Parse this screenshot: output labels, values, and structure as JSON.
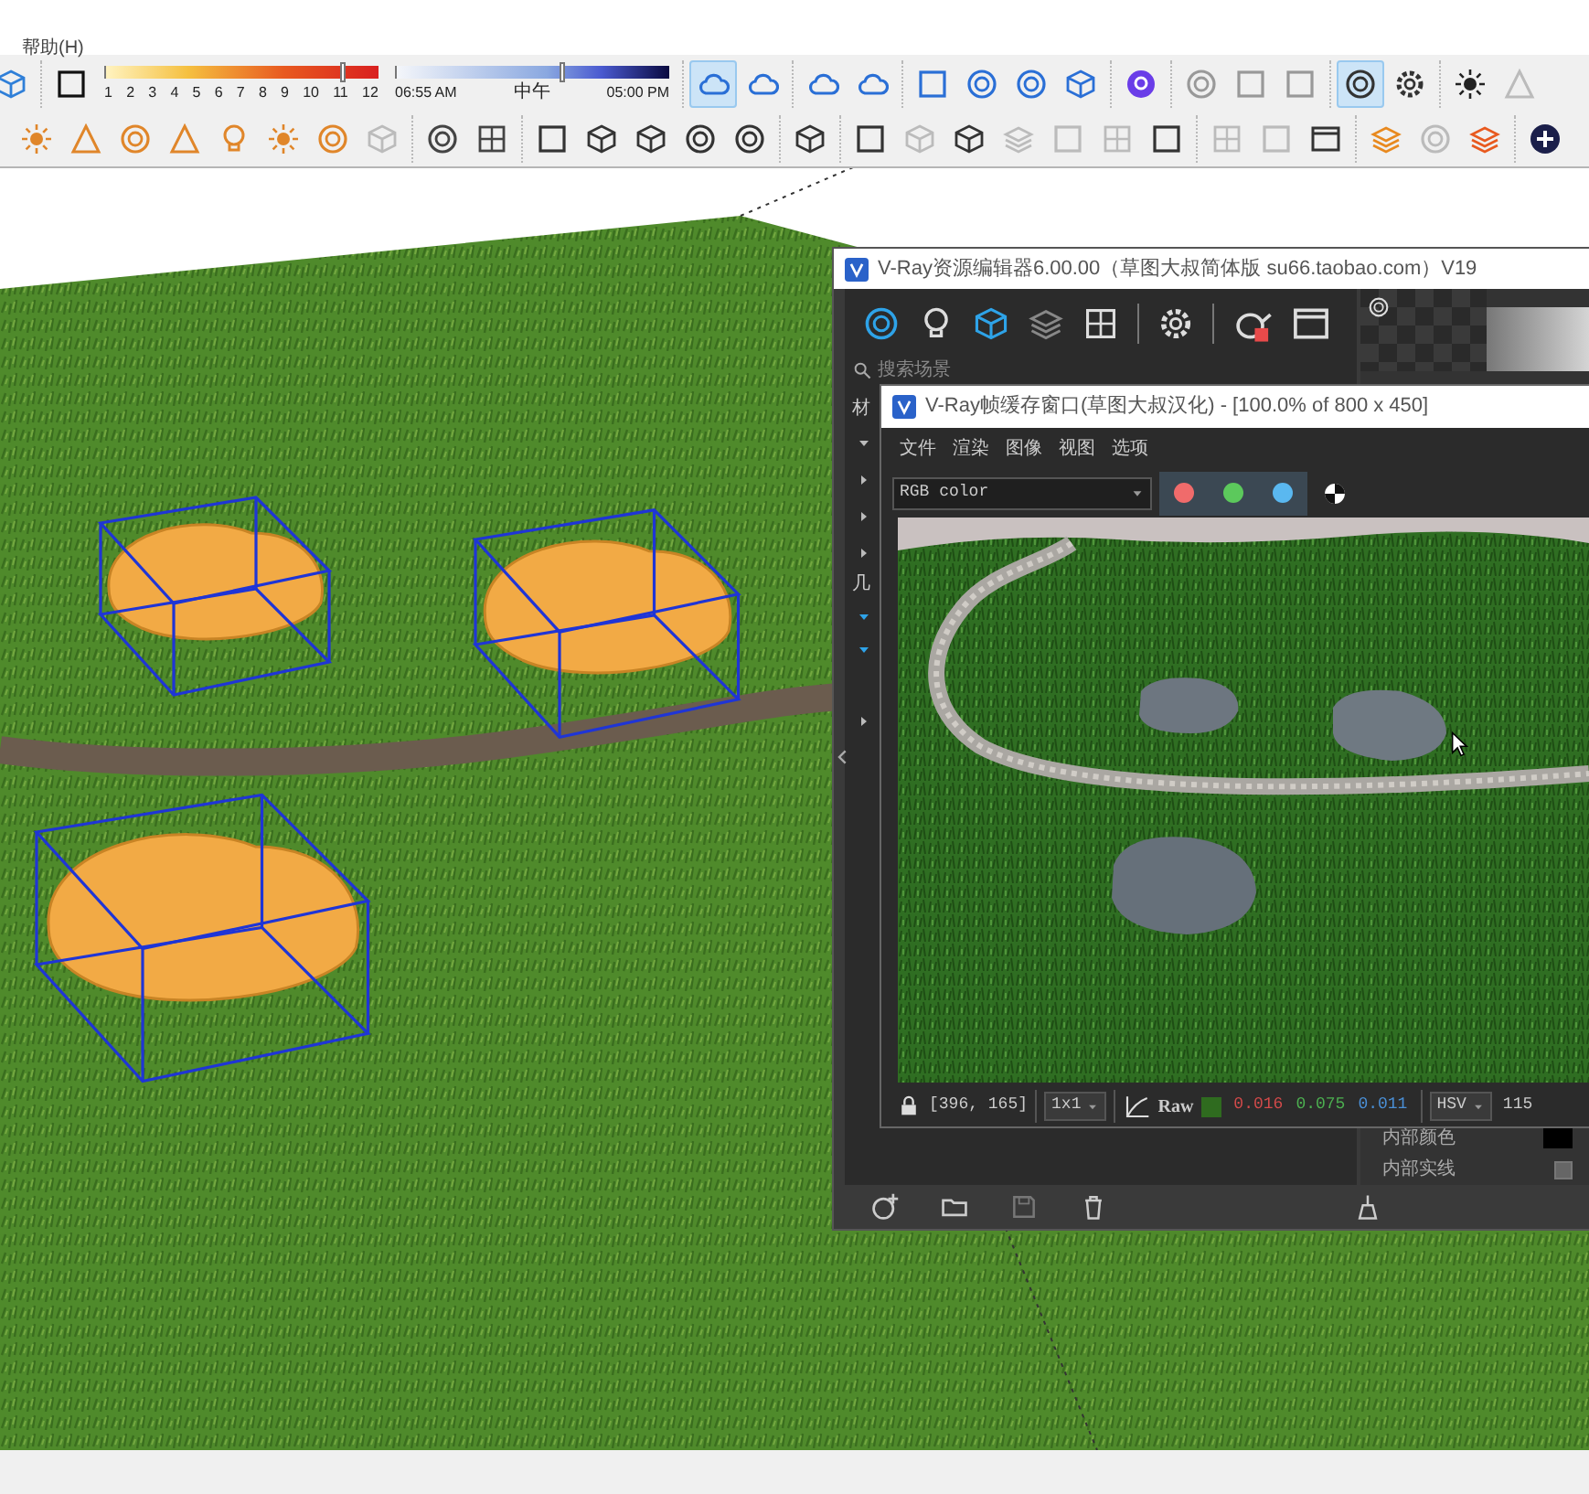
{
  "menu_bar": {
    "items": [
      "帮助(H)"
    ]
  },
  "toolbar_rows": [
    {
      "groups": [
        [
          {
            "kind": "button",
            "on": false
          }
        ],
        [
          {
            "kind": "button",
            "on": false
          },
          {
            "kind": "hour-scale",
            "labels": [
              "1",
              "2",
              "3",
              "4",
              "5",
              "6",
              "7",
              "8",
              "9",
              "10",
              "11",
              "12"
            ],
            "level": 0.87
          },
          {
            "kind": "time-slider",
            "labels": [
              "06:55 AM",
              "中午",
              "05:00 PM"
            ],
            "level": 0.61
          }
        ],
        [
          {
            "kind": "button",
            "on": true
          },
          {
            "kind": "button",
            "on": false
          }
        ],
        [
          {
            "kind": "button",
            "on": false
          },
          {
            "kind": "button",
            "on": false
          }
        ],
        [
          {
            "kind": "button",
            "on": false
          },
          {
            "kind": "button",
            "on": false
          },
          {
            "kind": "button",
            "on": false
          },
          {
            "kind": "button",
            "on": false
          }
        ],
        [
          {
            "kind": "button",
            "on": false
          }
        ],
        [
          {
            "kind": "button",
            "on": false
          },
          {
            "kind": "button",
            "on": false
          },
          {
            "kind": "button",
            "on": false
          }
        ],
        [
          {
            "kind": "button",
            "on": true
          },
          {
            "kind": "button",
            "on": false
          }
        ],
        [
          {
            "kind": "button",
            "on": false
          },
          {
            "kind": "button",
            "on": false
          }
        ]
      ]
    },
    {
      "groups": [
        [
          {
            "kind": "button",
            "disabled": false
          },
          {
            "kind": "button",
            "disabled": false
          },
          {
            "kind": "button",
            "disabled": false
          },
          {
            "kind": "button",
            "disabled": false
          },
          {
            "kind": "button",
            "disabled": false
          },
          {
            "kind": "button",
            "disabled": false
          },
          {
            "kind": "button",
            "disabled": false
          },
          {
            "kind": "button",
            "disabled": true
          }
        ],
        [
          {
            "kind": "button",
            "disabled": false
          },
          {
            "kind": "button",
            "disabled": false
          }
        ],
        [
          {
            "kind": "button",
            "disabled": false
          },
          {
            "kind": "button",
            "disabled": false
          },
          {
            "kind": "button",
            "disabled": false
          },
          {
            "kind": "button",
            "disabled": false
          },
          {
            "kind": "button",
            "disabled": false
          }
        ],
        [
          {
            "kind": "button",
            "disabled": false
          }
        ],
        [
          {
            "kind": "button",
            "disabled": false
          },
          {
            "kind": "button",
            "disabled": true
          },
          {
            "kind": "button",
            "disabled": false
          },
          {
            "kind": "button",
            "disabled": true
          },
          {
            "kind": "button",
            "disabled": true
          },
          {
            "kind": "button",
            "disabled": true
          },
          {
            "kind": "button",
            "disabled": false
          }
        ],
        [
          {
            "kind": "button",
            "disabled": true
          },
          {
            "kind": "button",
            "disabled": true
          },
          {
            "kind": "button",
            "disabled": false
          }
        ],
        [
          {
            "kind": "button",
            "disabled": false
          },
          {
            "kind": "button",
            "disabled": true
          },
          {
            "kind": "button",
            "disabled": false
          }
        ],
        [
          {
            "kind": "button",
            "disabled": false
          }
        ]
      ]
    }
  ],
  "viewport": {
    "objects": [
      {
        "selected": true
      },
      {
        "selected": true
      },
      {
        "selected": true
      }
    ]
  },
  "asset_editor": {
    "title": "V-Ray资源编辑器6.00.00（草图大叔简体版 su66.taobao.com）V19",
    "search": {
      "placeholder": "搜索场景"
    },
    "sections": [
      {
        "label": "材",
        "rows": [
          {
            "expanded": true,
            "selected": false
          },
          {
            "expanded": false,
            "selected": false
          },
          {
            "expanded": false,
            "selected": false
          },
          {
            "expanded": false,
            "selected": false
          }
        ]
      },
      {
        "label": "几",
        "rows": [
          {
            "expanded": true,
            "selected": true
          },
          {
            "expanded": true,
            "selected": true
          }
        ]
      },
      {
        "rows": [
          {
            "expanded": false,
            "selected": false
          }
        ]
      }
    ],
    "properties": [
      {
        "kind": "color",
        "label": "内部颜色",
        "color": "#000000"
      },
      {
        "kind": "checkbox",
        "label": "内部实线",
        "checked": false
      }
    ]
  },
  "frame_buffer": {
    "title": "V-Ray帧缓存窗口(草图大叔汉化) - [100.0% of 800 x 450]",
    "menu": [
      "文件",
      "渲染",
      "图像",
      "视图",
      "选项"
    ],
    "channel_select": "RGB color",
    "channel_buttons": [
      {
        "color": "#f06b6b",
        "on": true
      },
      {
        "color": "#5cc95c",
        "on": true
      },
      {
        "color": "#5ab8f0",
        "on": true
      }
    ],
    "status": {
      "coords": "[396, 165]",
      "zoom": "1x1",
      "mode": "Raw",
      "pixel_swatch": {
        "color": "#2f6b1f"
      },
      "values": [
        {
          "text": "0.016",
          "color": "#d24a4a"
        },
        {
          "text": "0.075",
          "color": "#4caf50"
        },
        {
          "text": "0.011",
          "color": "#4a8fd6"
        }
      ],
      "color_space": "HSV",
      "reading": "115"
    }
  }
}
